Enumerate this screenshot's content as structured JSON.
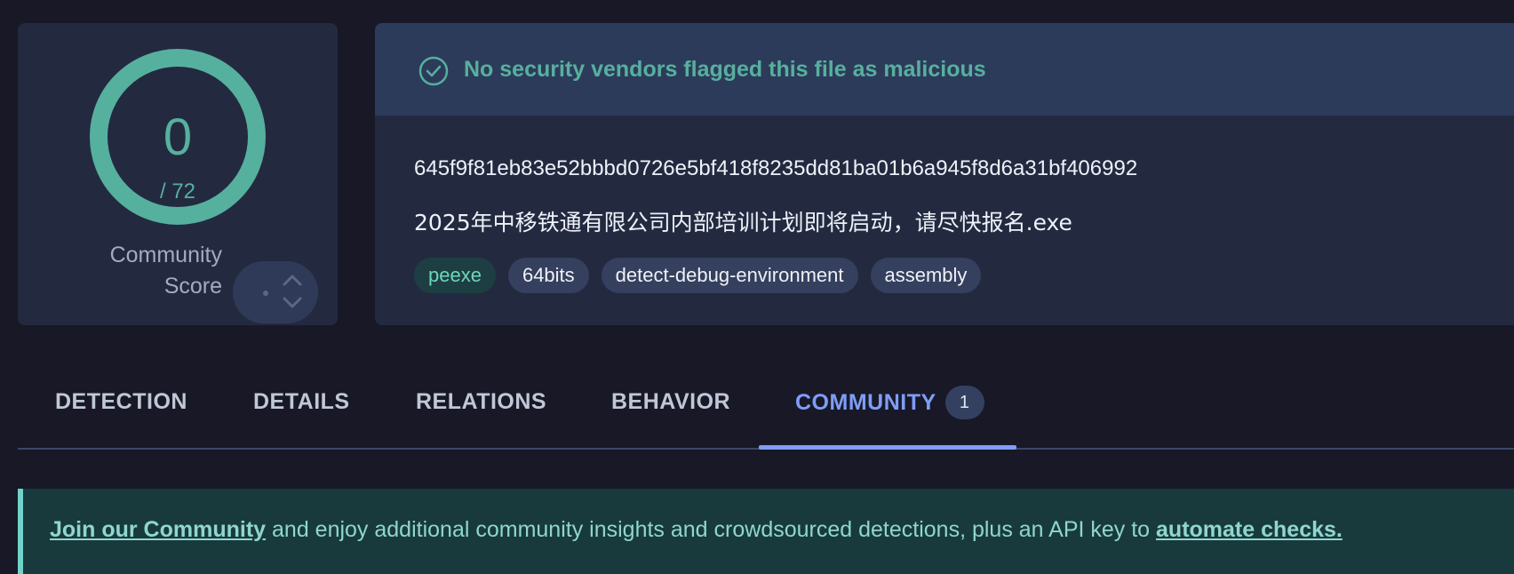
{
  "score": {
    "value": "0",
    "total": "/ 72",
    "community_label_line1": "Community",
    "community_label_line2": "Score",
    "ring_color": "#56b09e"
  },
  "verdict": {
    "text": "No security vendors flagged this file as malicious",
    "icon": "check-circle-icon",
    "color": "#56b09e"
  },
  "file": {
    "hash": "645f9f81eb83e52bbbd0726e5bf418f8235dd81ba01b6a945f8d6a31bf406992",
    "name": "2025年中移铁通有限公司内部培训计划即将启动，请尽快报名.exe"
  },
  "tags": [
    "peexe",
    "64bits",
    "detect-debug-environment",
    "assembly"
  ],
  "tabs": {
    "detection": "DETECTION",
    "details": "DETAILS",
    "relations": "RELATIONS",
    "behavior": "BEHAVIOR",
    "community": "COMMUNITY",
    "community_count": "1",
    "active": "COMMUNITY"
  },
  "banner": {
    "link1": "Join our Community",
    "text": " and enjoy additional community insights and crowdsourced detections, plus an API key to ",
    "link2": "automate checks."
  },
  "colors": {
    "background": "#181827",
    "card": "#232a40",
    "accent_green": "#56b09e",
    "accent_blue": "#7f9df7",
    "banner_bg": "#183a3c"
  }
}
